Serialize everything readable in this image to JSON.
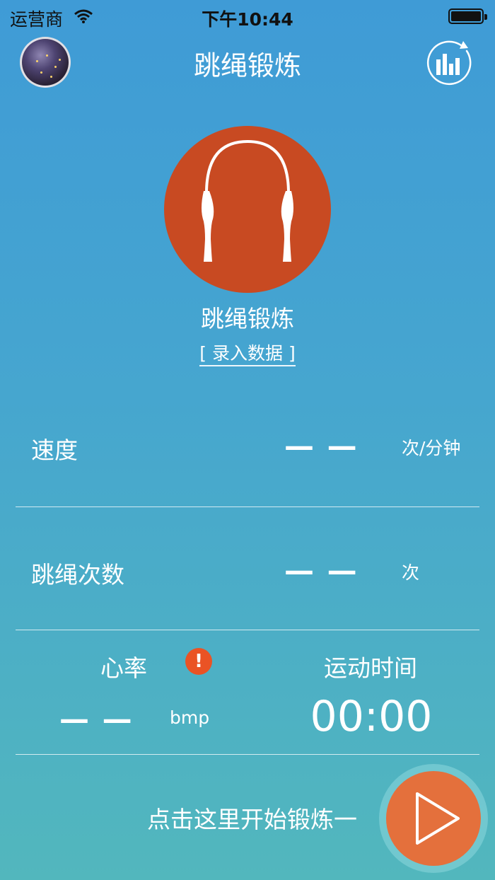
{
  "status_bar": {
    "carrier": "运营商",
    "time": "下午10:44"
  },
  "nav": {
    "title": "跳绳锻炼"
  },
  "hero": {
    "label": "跳绳锻炼",
    "record_link": "[ 录入数据 ]"
  },
  "speed": {
    "label": "速度",
    "value": "— —",
    "unit": "次/分钟"
  },
  "count": {
    "label": "跳绳次数",
    "value": "— —",
    "unit": "次"
  },
  "heart_rate": {
    "label": "心率",
    "value": "— —",
    "unit": "bmp",
    "alert": "!"
  },
  "exercise_time": {
    "label": "运动时间",
    "value": "00:00"
  },
  "start": {
    "label": "点击这里开始锻炼一"
  },
  "colors": {
    "accent": "#e4703c",
    "hero": "#c84a22",
    "alert": "#ea5325"
  },
  "icons": {
    "avatar": "avatar-photo",
    "stats": "bar-chart-icon",
    "hero": "jump-rope-icon",
    "alert": "exclamation-icon",
    "play": "play-icon"
  }
}
